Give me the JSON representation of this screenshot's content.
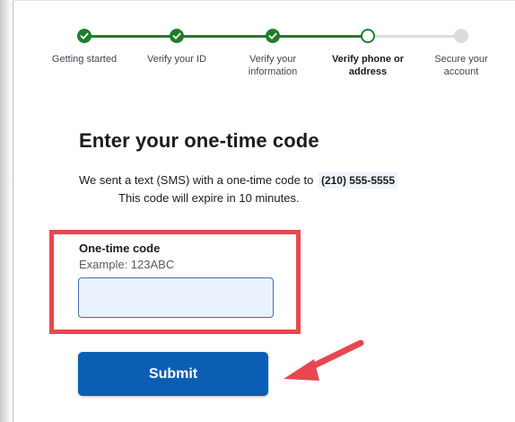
{
  "stepper": {
    "steps": [
      {
        "label": "Getting started",
        "state": "done"
      },
      {
        "label": "Verify your ID",
        "state": "done"
      },
      {
        "label": "Verify your information",
        "state": "done"
      },
      {
        "label": "Verify phone or address",
        "state": "current"
      },
      {
        "label": "Secure your account",
        "state": "todo"
      }
    ]
  },
  "main": {
    "heading": "Enter your one-time code",
    "sent_text": "We sent a text (SMS) with a one-time code to",
    "phone_number": "(210) 555-5555",
    "expire_text": "This code will expire in 10 minutes."
  },
  "form": {
    "code_label": "One-time code",
    "code_hint": "Example: 123ABC",
    "code_value": "",
    "submit_label": "Submit"
  },
  "colors": {
    "progress_green": "#1b7e2b",
    "button_blue": "#0a5fb5",
    "highlight_red": "#e8474f"
  }
}
